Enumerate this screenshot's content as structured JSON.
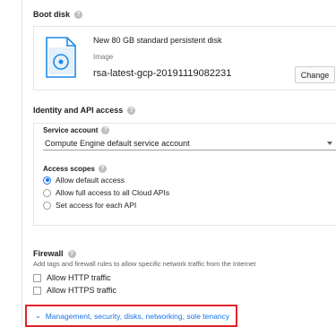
{
  "boot_disk": {
    "title": "Boot disk",
    "help_icon": "help-icon",
    "disk_name": "New 80 GB standard persistent disk",
    "type_label": "Image",
    "image_name": "rsa-latest-gcp-20191119082231",
    "change_label": "Change"
  },
  "identity": {
    "title": "Identity and API access",
    "service_account_label": "Service account",
    "service_account_value": "Compute Engine default service account",
    "access_scopes_label": "Access scopes",
    "scopes": [
      {
        "label": "Allow default access",
        "selected": true
      },
      {
        "label": "Allow full access to all Cloud APIs",
        "selected": false
      },
      {
        "label": "Set access for each API",
        "selected": false
      }
    ]
  },
  "firewall": {
    "title": "Firewall",
    "description": "Add tags and firewall rules to allow specific network traffic from the Internet",
    "options": [
      {
        "label": "Allow HTTP traffic",
        "checked": false
      },
      {
        "label": "Allow HTTPS traffic",
        "checked": false
      }
    ]
  },
  "management_link": "Management, security, disks, networking, sole tenancy",
  "colors": {
    "accent": "#1a73e8",
    "highlight_border": "#e1232b"
  }
}
